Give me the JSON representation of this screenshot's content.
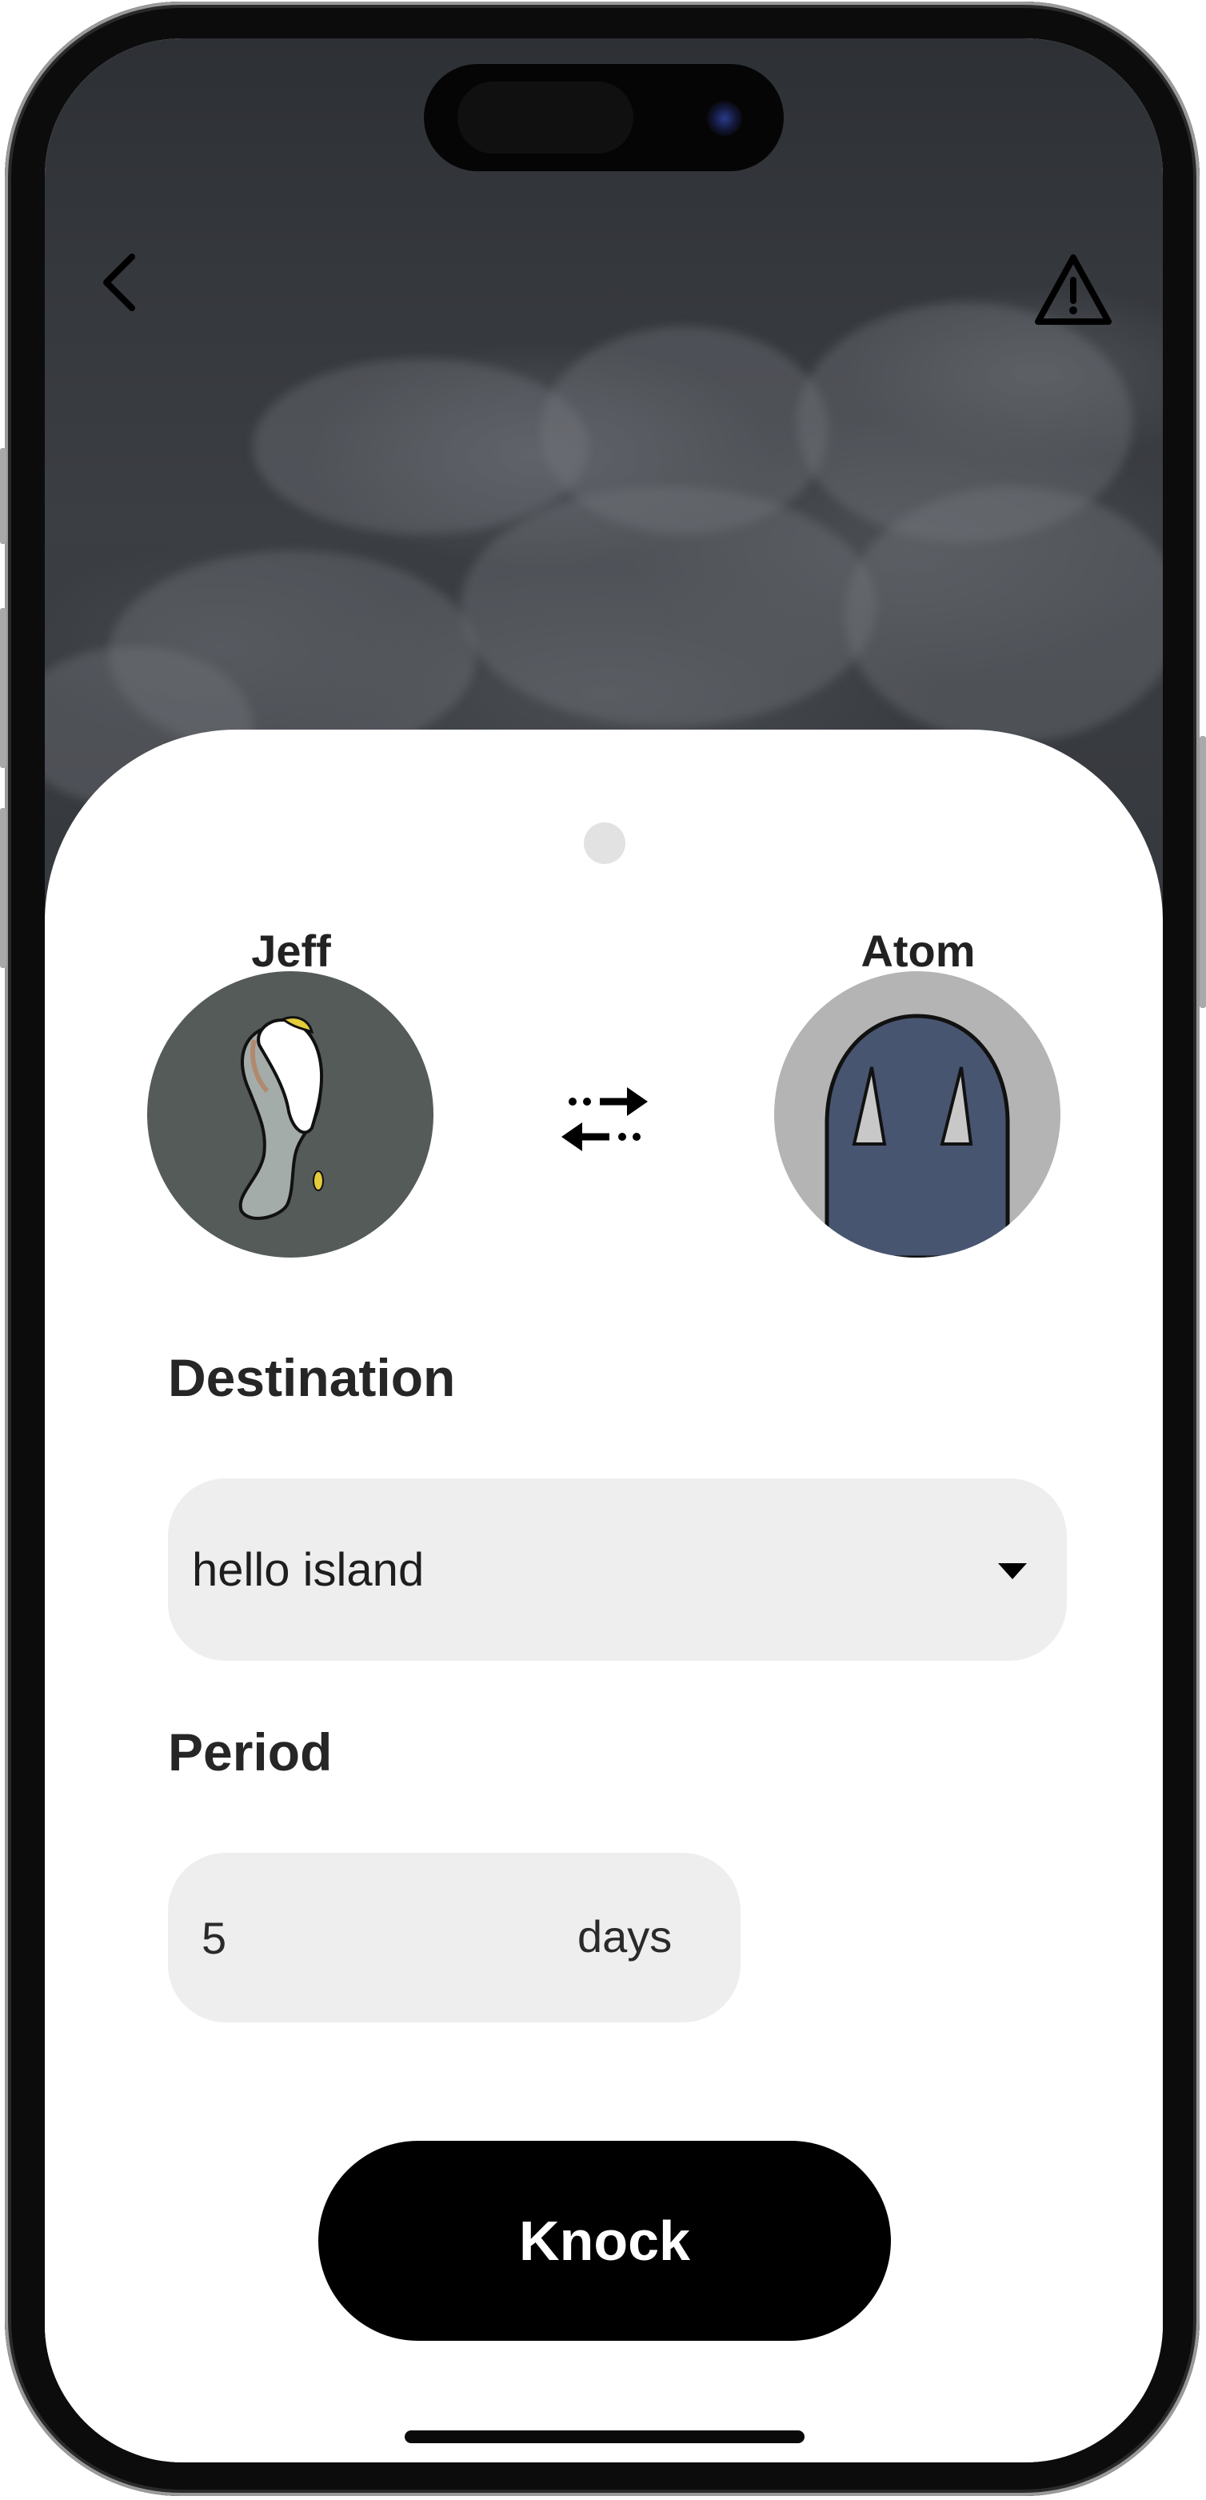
{
  "header": {
    "back_icon": "chevron-left-icon",
    "report_icon": "warning-triangle-icon"
  },
  "sender": {
    "name": "Jeff"
  },
  "receiver": {
    "name": "Atom"
  },
  "swap_icon": "swap-arrows-icon",
  "destination": {
    "title": "Destination",
    "value": "hello island",
    "dropdown_icon": "caret-down-icon"
  },
  "period": {
    "title": "Period",
    "value": "5",
    "unit": "days"
  },
  "actions": {
    "knock_label": "Knock"
  },
  "colors": {
    "sheet": "#ffffff",
    "field_bg": "#eeeeee",
    "button_bg": "#000000",
    "jeff_avatar_bg": "#545b59",
    "atom_avatar_bg": "#b4b4b4",
    "atom_body": "#485571"
  }
}
